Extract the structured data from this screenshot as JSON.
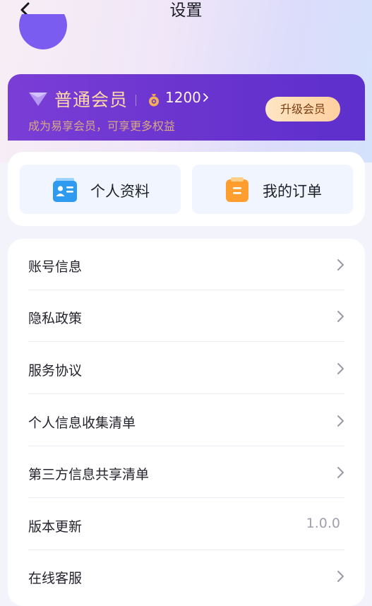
{
  "header": {
    "title": "设置",
    "back_icon": "chevron-left-icon"
  },
  "member": {
    "level": "普通会员",
    "points": "1200",
    "description": "成为易享会员，可享更多权益",
    "upgrade_label": "升级会员",
    "accent": "#6b34cf",
    "gold": "#ffd9a8"
  },
  "quick_actions": [
    {
      "label": "个人资料",
      "icon": "profile-card-icon"
    },
    {
      "label": "我的订单",
      "icon": "order-clipboard-icon"
    }
  ],
  "settings": [
    {
      "label": "账号信息"
    },
    {
      "label": "隐私政策"
    },
    {
      "label": "服务协议"
    },
    {
      "label": "个人信息收集清单"
    },
    {
      "label": "第三方信息共享清单"
    },
    {
      "label": "版本更新",
      "value": "1.0.0"
    },
    {
      "label": "在线客服"
    }
  ]
}
